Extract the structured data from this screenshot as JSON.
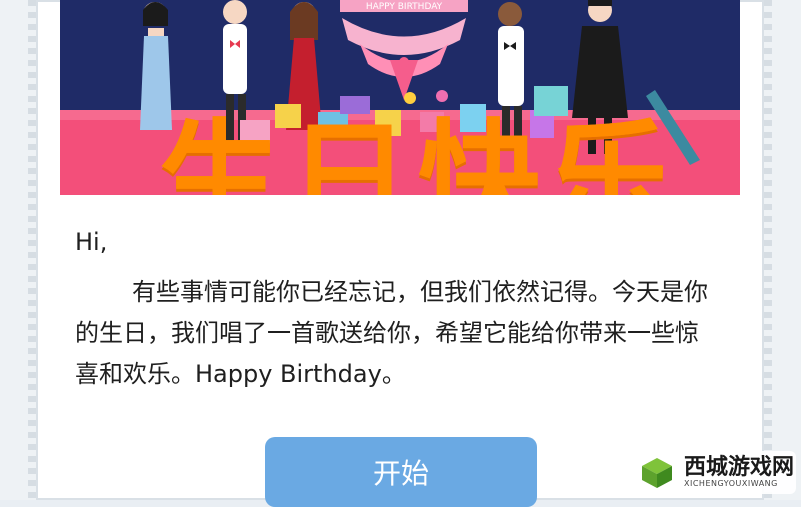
{
  "banner": {
    "cake_text": "HAPPY BIRTHDAY",
    "title": "生日快乐"
  },
  "message": {
    "greeting": "Hi,",
    "paragraph": "有些事情可能你已经忘记，但我们依然记得。今天是你的生日，我们唱了一首歌送给你，希望它能给你带来一些惊喜和欢乐。Happy Birthday。"
  },
  "actions": {
    "start_label": "开始"
  },
  "watermark": {
    "name": "西城游戏网",
    "domain": "XICHENGYOUXIWANG"
  },
  "colors": {
    "banner_bg": "#1f2b67",
    "stage": "#f34f7a",
    "title": "#ff8a00",
    "button": "#6aa9e3"
  }
}
